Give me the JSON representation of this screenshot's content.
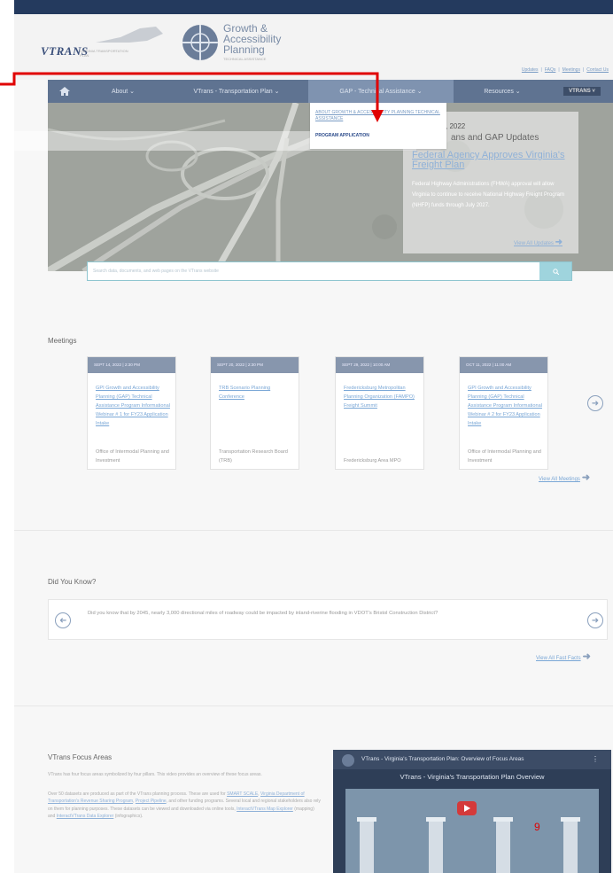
{
  "header": {
    "vtrans_logo": "VTRANS",
    "vtrans_subtitle": "VIRGINIA TRANSPORTATION PLAN",
    "gap_title": "Growth & Accessibility Planning",
    "gap_tagline": "TECHNICAL ASSISTANCE",
    "utility_links": [
      "Updates",
      "FAQs",
      "Meetings",
      "Contact Us"
    ]
  },
  "nav": {
    "home_icon": "home-icon",
    "about": "About ⌄",
    "vtrans_plan": "VTrans - Transportation Plan ⌄",
    "gap": "GAP - Technical Assistance ⌄",
    "resources": "Resources ⌄",
    "badge": "VTRANS ˅"
  },
  "dropdown": {
    "item1": "ABOUT GROWTH & ACCESSIBILITY PLANNING TECHNICAL ASSISTANCE",
    "item2": "PROGRAM APPLICATION"
  },
  "updates": {
    "date": ", 2022",
    "heading": "ans and GAP Updates",
    "feature_title": "Federal Agency Approves Virginia's Freight Plan",
    "feature_body": "Federal Highway Administrations (FHWA) approval will allow Virginia to continue to receive National Highway Freight Program (NHFP) funds through July 2027.",
    "view_all": "View All Updates"
  },
  "search": {
    "placeholder": "Search data, documents, and web pages on the VTrans website",
    "button_icon": "search-icon"
  },
  "meetings": {
    "heading": "Meetings",
    "cards": [
      {
        "date": "SEPT 14, 2022 | 2:30 PM",
        "title": "GPI Growth and Accessibility Planning (GAP) Technical Assistance Program Informational Webinar # 1 for FY23 Application Intake",
        "org": "Office of Intermodal Planning and Investment"
      },
      {
        "date": "SEPT 20, 2022 | 2:30 PM",
        "title": "TRB Scenario Planning Conference",
        "org": "Transportation Research Board (TRB)"
      },
      {
        "date": "SEPT 29, 2022 | 10:00 AM",
        "title": "Fredericksburg Metropolitan Planning Organization (FAMPO) Freight Summit",
        "org": "Fredericksburg Area MPO"
      },
      {
        "date": "OCT 11, 2022 | 11:00 AM",
        "title": "GPI Growth and Accessibility Planning (GAP) Technical Assistance Program Informational Webinar # 2 for FY23 Application Intake",
        "org": "Office of Intermodal Planning and Investment"
      }
    ],
    "view_all": "View All Meetings"
  },
  "did_you_know": {
    "heading": "Did You Know?",
    "text": "Did you know that by 2045, nearly 3,000 directional miles of roadway could be impacted by inland-riverine flooding in VDOT's Bristol Construction District?",
    "view_all": "View All Fast Facts"
  },
  "focus": {
    "heading": "VTrans Focus Areas",
    "p1": "VTrans has four focus areas symbolized by four pillars. This video provides an overview of these focus areas.",
    "p2_start": "Over 50 datasets are produced as part of the VTrans planning process. These are used for ",
    "link1": "SMART SCALE",
    "link2": "Virginia Department of Transportation's Revenue Sharing Program",
    "link3": "Project Pipeline",
    "p2_mid": ", and other funding programs. Several local and regional stakeholders also rely on them for planning purposes. These datasets can be viewed and downloaded via online tools, ",
    "link4": "InteractVTrans Map Explorer",
    "p2_mid2": " (mapping) and ",
    "link5": "InteractVTrans Data Explorer",
    "p2_end": " (infographics)."
  },
  "video": {
    "title": "VTrans - Virginia's Transportation Plan: Overview of Focus Areas",
    "subtitle": "VTrans - Virginia's Transportation Plan Overview"
  },
  "annotation": {
    "number": "9",
    "color": "#e00000"
  }
}
